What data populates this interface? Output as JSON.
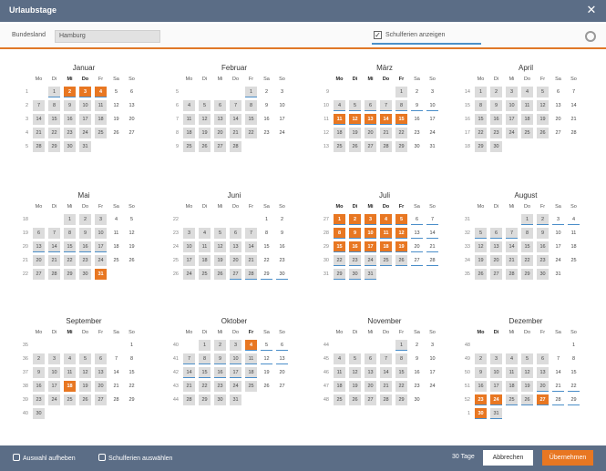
{
  "window": {
    "title": "Urlaubstage",
    "close_icon": "close-icon"
  },
  "filter": {
    "label": "Bundesland",
    "value": "Hamburg",
    "school_holidays_label": "Schulferien anzeigen",
    "school_holidays_checked": true,
    "settings_icon": "gear-icon"
  },
  "colors": {
    "selected": "#e87722",
    "workday": "#dcdcdc",
    "holiday_underline": "#4a8ec9",
    "bar": "#5b6d86"
  },
  "weekday_labels": [
    "Mo",
    "Di",
    "Mi",
    "Do",
    "Fr",
    "Sa",
    "So"
  ],
  "months": [
    {
      "name": "Januar",
      "bold": [
        2,
        3
      ],
      "weeks": [
        {
          "kw": "1",
          "days": [
            null,
            "1",
            "2",
            "3",
            "4",
            "5",
            "6"
          ]
        },
        {
          "kw": "2",
          "days": [
            "7",
            "8",
            "9",
            "10",
            "11",
            "12",
            "13"
          ]
        },
        {
          "kw": "3",
          "days": [
            "14",
            "15",
            "16",
            "17",
            "18",
            "19",
            "20"
          ]
        },
        {
          "kw": "4",
          "days": [
            "21",
            "22",
            "23",
            "24",
            "25",
            "26",
            "27"
          ]
        },
        {
          "kw": "5",
          "days": [
            "28",
            "29",
            "30",
            "31",
            null,
            null,
            null
          ]
        }
      ],
      "selected": [
        "2",
        "3",
        "4"
      ],
      "holiday": [
        "1",
        "2",
        "3",
        "4"
      ]
    },
    {
      "name": "Februar",
      "bold": [],
      "weeks": [
        {
          "kw": "5",
          "days": [
            null,
            null,
            null,
            null,
            "1",
            "2",
            "3"
          ]
        },
        {
          "kw": "6",
          "days": [
            "4",
            "5",
            "6",
            "7",
            "8",
            "9",
            "10"
          ]
        },
        {
          "kw": "7",
          "days": [
            "11",
            "12",
            "13",
            "14",
            "15",
            "16",
            "17"
          ]
        },
        {
          "kw": "8",
          "days": [
            "18",
            "19",
            "20",
            "21",
            "22",
            "23",
            "24"
          ]
        },
        {
          "kw": "9",
          "days": [
            "25",
            "26",
            "27",
            "28",
            null,
            null,
            null
          ]
        }
      ],
      "selected": [],
      "holiday": [
        "1"
      ]
    },
    {
      "name": "März",
      "bold": [
        0,
        1,
        2,
        3,
        4
      ],
      "weeks": [
        {
          "kw": "9",
          "days": [
            null,
            null,
            null,
            null,
            "1",
            "2",
            "3"
          ]
        },
        {
          "kw": "10",
          "days": [
            "4",
            "5",
            "6",
            "7",
            "8",
            "9",
            "10"
          ]
        },
        {
          "kw": "11",
          "days": [
            "11",
            "12",
            "13",
            "14",
            "15",
            "16",
            "17"
          ]
        },
        {
          "kw": "12",
          "days": [
            "18",
            "19",
            "20",
            "21",
            "22",
            "23",
            "24"
          ]
        },
        {
          "kw": "13",
          "days": [
            "25",
            "26",
            "27",
            "28",
            "29",
            "30",
            "31"
          ]
        }
      ],
      "selected": [
        "11",
        "12",
        "13",
        "14",
        "15"
      ],
      "holiday": [
        "4",
        "5",
        "6",
        "7",
        "8",
        "9",
        "10",
        "11",
        "12",
        "13",
        "14",
        "15"
      ]
    },
    {
      "name": "April",
      "bold": [],
      "weeks": [
        {
          "kw": "14",
          "days": [
            "1",
            "2",
            "3",
            "4",
            "5",
            "6",
            "7"
          ]
        },
        {
          "kw": "15",
          "days": [
            "8",
            "9",
            "10",
            "11",
            "12",
            "13",
            "14"
          ]
        },
        {
          "kw": "16",
          "days": [
            "15",
            "16",
            "17",
            "18",
            "19",
            "20",
            "21"
          ]
        },
        {
          "kw": "17",
          "days": [
            "22",
            "23",
            "24",
            "25",
            "26",
            "27",
            "28"
          ]
        },
        {
          "kw": "18",
          "days": [
            "29",
            "30",
            null,
            null,
            null,
            null,
            null
          ]
        }
      ],
      "selected": [],
      "holiday": []
    },
    {
      "name": "Mai",
      "bold": [],
      "weeks": [
        {
          "kw": "18",
          "days": [
            null,
            null,
            "1",
            "2",
            "3",
            "4",
            "5"
          ]
        },
        {
          "kw": "19",
          "days": [
            "6",
            "7",
            "8",
            "9",
            "10",
            "11",
            "12"
          ]
        },
        {
          "kw": "20",
          "days": [
            "13",
            "14",
            "15",
            "16",
            "17",
            "18",
            "19"
          ]
        },
        {
          "kw": "21",
          "days": [
            "20",
            "21",
            "22",
            "23",
            "24",
            "25",
            "26"
          ]
        },
        {
          "kw": "22",
          "days": [
            "27",
            "28",
            "29",
            "30",
            "31",
            null,
            null
          ]
        }
      ],
      "selected": [
        "31"
      ],
      "holiday": [
        "13",
        "14",
        "15",
        "16",
        "17"
      ]
    },
    {
      "name": "Juni",
      "bold": [],
      "weeks": [
        {
          "kw": "22",
          "days": [
            null,
            null,
            null,
            null,
            null,
            "1",
            "2"
          ]
        },
        {
          "kw": "23",
          "days": [
            "3",
            "4",
            "5",
            "6",
            "7",
            "8",
            "9"
          ]
        },
        {
          "kw": "24",
          "days": [
            "10",
            "11",
            "12",
            "13",
            "14",
            "15",
            "16"
          ]
        },
        {
          "kw": "25",
          "days": [
            "17",
            "18",
            "19",
            "20",
            "21",
            "22",
            "23"
          ]
        },
        {
          "kw": "26",
          "days": [
            "24",
            "25",
            "26",
            "27",
            "28",
            "29",
            "30"
          ]
        }
      ],
      "selected": [],
      "holiday": [
        "27",
        "28",
        "29",
        "30"
      ]
    },
    {
      "name": "Juli",
      "bold": [
        0,
        1,
        2,
        3,
        4
      ],
      "weeks": [
        {
          "kw": "27",
          "days": [
            "1",
            "2",
            "3",
            "4",
            "5",
            "6",
            "7"
          ]
        },
        {
          "kw": "28",
          "days": [
            "8",
            "9",
            "10",
            "11",
            "12",
            "13",
            "14"
          ]
        },
        {
          "kw": "29",
          "days": [
            "15",
            "16",
            "17",
            "18",
            "19",
            "20",
            "21"
          ]
        },
        {
          "kw": "30",
          "days": [
            "22",
            "23",
            "24",
            "25",
            "26",
            "27",
            "28"
          ]
        },
        {
          "kw": "31",
          "days": [
            "29",
            "30",
            "31",
            null,
            null,
            null,
            null
          ]
        }
      ],
      "selected": [
        "1",
        "2",
        "3",
        "4",
        "5",
        "8",
        "9",
        "10",
        "11",
        "12",
        "15",
        "16",
        "17",
        "18",
        "19"
      ],
      "holiday": [
        "1",
        "2",
        "3",
        "4",
        "5",
        "6",
        "7",
        "8",
        "9",
        "10",
        "11",
        "12",
        "13",
        "14",
        "15",
        "16",
        "17",
        "18",
        "19",
        "20",
        "21",
        "22",
        "23",
        "24",
        "25",
        "26",
        "27",
        "28",
        "29",
        "30",
        "31"
      ]
    },
    {
      "name": "August",
      "bold": [],
      "weeks": [
        {
          "kw": "31",
          "days": [
            null,
            null,
            null,
            "1",
            "2",
            "3",
            "4"
          ]
        },
        {
          "kw": "32",
          "days": [
            "5",
            "6",
            "7",
            "8",
            "9",
            "10",
            "11"
          ]
        },
        {
          "kw": "33",
          "days": [
            "12",
            "13",
            "14",
            "15",
            "16",
            "17",
            "18"
          ]
        },
        {
          "kw": "34",
          "days": [
            "19",
            "20",
            "21",
            "22",
            "23",
            "24",
            "25"
          ]
        },
        {
          "kw": "35",
          "days": [
            "26",
            "27",
            "28",
            "29",
            "30",
            "31",
            null
          ]
        }
      ],
      "selected": [],
      "holiday": [
        "1",
        "2",
        "3",
        "4",
        "5",
        "6",
        "7"
      ]
    },
    {
      "name": "September",
      "bold": [
        2
      ],
      "weeks": [
        {
          "kw": "35",
          "days": [
            null,
            null,
            null,
            null,
            null,
            null,
            "1"
          ]
        },
        {
          "kw": "36",
          "days": [
            "2",
            "3",
            "4",
            "5",
            "6",
            "7",
            "8"
          ]
        },
        {
          "kw": "37",
          "days": [
            "9",
            "10",
            "11",
            "12",
            "13",
            "14",
            "15"
          ]
        },
        {
          "kw": "38",
          "days": [
            "16",
            "17",
            "18",
            "19",
            "20",
            "21",
            "22"
          ]
        },
        {
          "kw": "39",
          "days": [
            "23",
            "24",
            "25",
            "26",
            "27",
            "28",
            "29"
          ]
        },
        {
          "kw": "40",
          "days": [
            "30",
            null,
            null,
            null,
            null,
            null,
            null
          ]
        }
      ],
      "selected": [
        "18"
      ],
      "holiday": []
    },
    {
      "name": "Oktober",
      "bold": [
        4
      ],
      "weeks": [
        {
          "kw": "40",
          "days": [
            null,
            "1",
            "2",
            "3",
            "4",
            "5",
            "6"
          ]
        },
        {
          "kw": "41",
          "days": [
            "7",
            "8",
            "9",
            "10",
            "11",
            "12",
            "13"
          ]
        },
        {
          "kw": "42",
          "days": [
            "14",
            "15",
            "16",
            "17",
            "18",
            "19",
            "20"
          ]
        },
        {
          "kw": "43",
          "days": [
            "21",
            "22",
            "23",
            "24",
            "25",
            "26",
            "27"
          ]
        },
        {
          "kw": "44",
          "days": [
            "28",
            "29",
            "30",
            "31",
            null,
            null,
            null
          ]
        }
      ],
      "selected": [
        "4"
      ],
      "holiday": [
        "4",
        "5",
        "6",
        "7",
        "8",
        "9",
        "10",
        "11",
        "12",
        "13",
        "14",
        "15",
        "16",
        "17",
        "18"
      ]
    },
    {
      "name": "November",
      "bold": [],
      "weeks": [
        {
          "kw": "44",
          "days": [
            null,
            null,
            null,
            null,
            "1",
            "2",
            "3"
          ]
        },
        {
          "kw": "45",
          "days": [
            "4",
            "5",
            "6",
            "7",
            "8",
            "9",
            "10"
          ]
        },
        {
          "kw": "46",
          "days": [
            "11",
            "12",
            "13",
            "14",
            "15",
            "16",
            "17"
          ]
        },
        {
          "kw": "47",
          "days": [
            "18",
            "19",
            "20",
            "21",
            "22",
            "23",
            "24"
          ]
        },
        {
          "kw": "48",
          "days": [
            "25",
            "26",
            "27",
            "28",
            "29",
            "30",
            null
          ]
        }
      ],
      "selected": [],
      "holiday": [
        "1"
      ]
    },
    {
      "name": "Dezember",
      "bold": [
        0,
        1
      ],
      "weeks": [
        {
          "kw": "48",
          "days": [
            null,
            null,
            null,
            null,
            null,
            null,
            "1"
          ]
        },
        {
          "kw": "49",
          "days": [
            "2",
            "3",
            "4",
            "5",
            "6",
            "7",
            "8"
          ]
        },
        {
          "kw": "50",
          "days": [
            "9",
            "10",
            "11",
            "12",
            "13",
            "14",
            "15"
          ]
        },
        {
          "kw": "51",
          "days": [
            "16",
            "17",
            "18",
            "19",
            "20",
            "21",
            "22"
          ]
        },
        {
          "kw": "52",
          "days": [
            "23",
            "24",
            "25",
            "26",
            "27",
            "28",
            "29"
          ]
        },
        {
          "kw": "1",
          "days": [
            "30",
            "31",
            null,
            null,
            null,
            null,
            null
          ]
        }
      ],
      "selected": [
        "23",
        "24",
        "27",
        "30"
      ],
      "holiday": [
        "20",
        "21",
        "22",
        "23",
        "24",
        "25",
        "26",
        "27",
        "28",
        "29",
        "30",
        "31"
      ]
    }
  ],
  "footer": {
    "clear_label": "Auswahl aufheben",
    "select_holidays_label": "Schulferien auswählen",
    "days_count": "30 Tage",
    "cancel_label": "Abbrechen",
    "ok_label": "Übernehmen"
  }
}
